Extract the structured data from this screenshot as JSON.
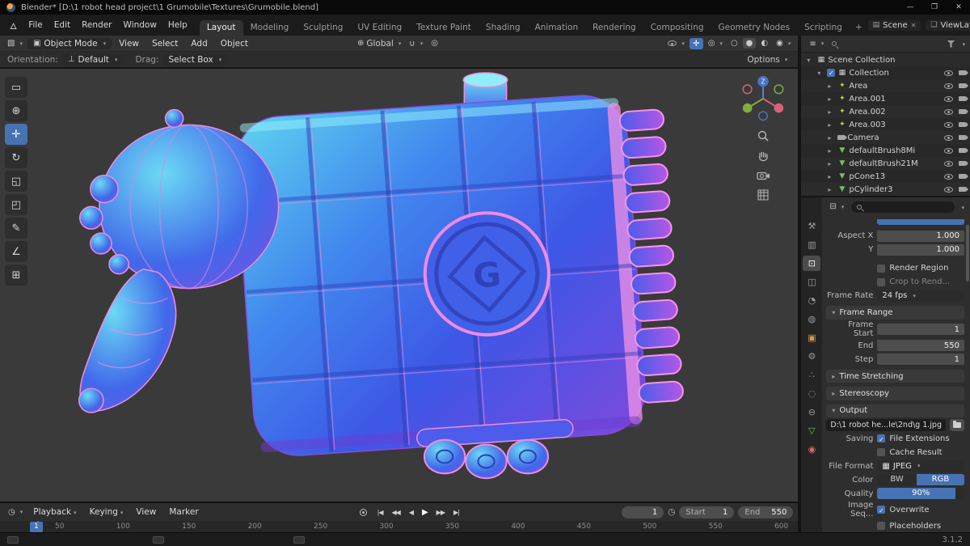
{
  "colors": {
    "accent": "#4772b3",
    "viewport_bg": "#3a3a3a"
  },
  "titlebar": {
    "title": "Blender* [D:\\1 robot head project\\1 Grumobile\\Textures\\Grumobile.blend]"
  },
  "topbar": {
    "menus": [
      "File",
      "Edit",
      "Render",
      "Window",
      "Help"
    ],
    "workspaces": [
      "Layout",
      "Modeling",
      "Sculpting",
      "UV Editing",
      "Texture Paint",
      "Shading",
      "Animation",
      "Rendering",
      "Compositing",
      "Geometry Nodes",
      "Scripting"
    ],
    "add_workspace": "+",
    "scene": "Scene",
    "viewlayer": "ViewLayer"
  },
  "viewport": {
    "mode": "Object Mode",
    "menus": [
      "View",
      "Select",
      "Add",
      "Object"
    ],
    "orientation": "Global",
    "gizmo_axis": "Z",
    "tools": [
      {
        "name": "select-box",
        "glyph": "▭"
      },
      {
        "name": "cursor",
        "glyph": "⊕"
      },
      {
        "name": "move",
        "glyph": "✛"
      },
      {
        "name": "rotate",
        "glyph": "↻"
      },
      {
        "name": "scale",
        "glyph": "◱"
      },
      {
        "name": "transform",
        "glyph": "◰"
      },
      {
        "name": "annotate",
        "glyph": "✎"
      },
      {
        "name": "measure",
        "glyph": "∠"
      },
      {
        "name": "add-cube",
        "glyph": "⊞"
      }
    ]
  },
  "tool_settings": {
    "orientation_label": "Orientation:",
    "orientation_value": "Default",
    "drag_label": "Drag:",
    "drag_value": "Select Box",
    "options": "Options"
  },
  "model": {
    "emblem_letter": "G"
  },
  "outliner": {
    "root": "Scene Collection",
    "items": [
      {
        "name": "Collection",
        "type": "collection"
      },
      {
        "name": "Area",
        "type": "light"
      },
      {
        "name": "Area.001",
        "type": "light"
      },
      {
        "name": "Area.002",
        "type": "light"
      },
      {
        "name": "Area.003",
        "type": "light"
      },
      {
        "name": "Camera",
        "type": "camera"
      },
      {
        "name": "defaultBrush8Mi",
        "type": "mesh"
      },
      {
        "name": "defaultBrush21M",
        "type": "mesh"
      },
      {
        "name": "pCone13",
        "type": "mesh"
      },
      {
        "name": "pCylinder3",
        "type": "mesh"
      }
    ]
  },
  "properties": {
    "tabs": [
      {
        "name": "tool",
        "glyph": "⚒"
      },
      {
        "name": "render",
        "glyph": "▥"
      },
      {
        "name": "output",
        "glyph": "⊡"
      },
      {
        "name": "view-layer",
        "glyph": "◫"
      },
      {
        "name": "scene",
        "glyph": "◔"
      },
      {
        "name": "world",
        "glyph": "◍"
      },
      {
        "name": "object",
        "glyph": "▣"
      },
      {
        "name": "modifiers",
        "glyph": "⚙"
      },
      {
        "name": "particles",
        "glyph": "∴"
      },
      {
        "name": "physics",
        "glyph": "◌"
      },
      {
        "name": "constraints",
        "glyph": "⊖"
      },
      {
        "name": "object-data",
        "glyph": "▽"
      },
      {
        "name": "material",
        "glyph": "◉"
      }
    ],
    "aspect_x_label": "Aspect X",
    "aspect_x_value": "1.000",
    "aspect_y_label": "Y",
    "aspect_y_value": "1.000",
    "render_region_label": "Render Region",
    "crop_label": "Crop to Rend...",
    "frame_rate_label": "Frame Rate",
    "frame_rate_value": "24 fps",
    "frame_range_title": "Frame Range",
    "frame_start_label": "Frame Start",
    "frame_start_value": "1",
    "end_label": "End",
    "end_value": "550",
    "step_label": "Step",
    "step_value": "1",
    "time_stretching_title": "Time Stretching",
    "stereoscopy_title": "Stereoscopy",
    "output_title": "Output",
    "output_path": "D:\\1 robot he...le\\2nd\\g 1.jpg",
    "saving_label": "Saving",
    "file_extensions_label": "File Extensions",
    "cache_result_label": "Cache Result",
    "file_format_label": "File Format",
    "file_format_value": "JPEG",
    "color_label": "Color",
    "color_bw": "BW",
    "color_rgb": "RGB",
    "quality_label": "Quality",
    "quality_value": "90%",
    "image_seq_label": "Image Seq...",
    "overwrite_label": "Overwrite",
    "placeholders_label": "Placeholders"
  },
  "timeline": {
    "menus": [
      "Playback",
      "Keying",
      "View",
      "Marker"
    ],
    "transport": [
      "|◀",
      "◀◀",
      "◀",
      "▶",
      "▶▶",
      "▶|"
    ],
    "current_frame": "1",
    "start_label": "Start",
    "start_value": "1",
    "end_label": "End",
    "end_value": "550",
    "ticks": [
      "50",
      "100",
      "150",
      "200",
      "250",
      "300",
      "350",
      "400",
      "450",
      "500",
      "550",
      "600"
    ]
  },
  "statusbar": {
    "version": "3.1.2"
  }
}
